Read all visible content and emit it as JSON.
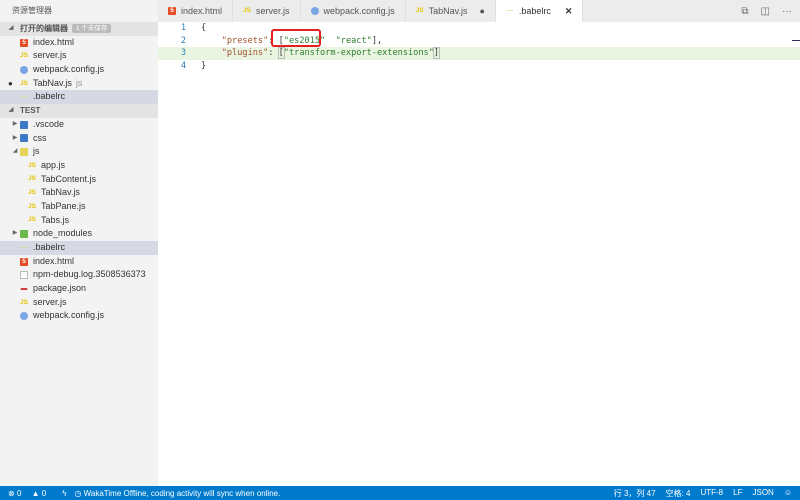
{
  "sidebar": {
    "title": "资源管理器",
    "open_editors": {
      "label": "打开的编辑器",
      "badge": "1 个未保存",
      "items": [
        {
          "name": "index.html",
          "icon": "html"
        },
        {
          "name": "server.js",
          "icon": "js"
        },
        {
          "name": "webpack.config.js",
          "icon": "webpack"
        },
        {
          "name": "TabNav.js",
          "icon": "js",
          "extra": "js",
          "unsaved": true
        },
        {
          "name": ".babelrc",
          "icon": "babel",
          "selected": true
        }
      ]
    },
    "project": {
      "label": "TEST",
      "items": [
        {
          "name": ".vscode",
          "type": "folder"
        },
        {
          "name": "css",
          "type": "folder"
        },
        {
          "name": "js",
          "type": "folder",
          "expanded": true
        },
        {
          "name": "app.js"
        },
        {
          "name": "TabContent.js"
        },
        {
          "name": "TabNav.js"
        },
        {
          "name": "TabPane.js"
        },
        {
          "name": "Tabs.js"
        },
        {
          "name": "node_modules",
          "type": "folder"
        },
        {
          "name": ".babelrc",
          "selected": true
        },
        {
          "name": "index.html"
        },
        {
          "name": "npm-debug.log.3508536373"
        },
        {
          "name": "package.json"
        },
        {
          "name": "server.js"
        },
        {
          "name": "webpack.config.js"
        }
      ]
    }
  },
  "tabs": [
    {
      "label": "index.html"
    },
    {
      "label": "server.js"
    },
    {
      "label": "webpack.config.js"
    },
    {
      "label": "TabNav.js",
      "dirty": "●"
    },
    {
      "label": ".babelrc",
      "close": "✕"
    }
  ],
  "editor": {
    "lines": [
      {
        "n": "1",
        "t": "{"
      },
      {
        "n": "2",
        "key": "\"presets\"",
        "sep": ": ",
        "a": "[",
        "s1": "\"es2015\"",
        "mid": "  ",
        "s2": "\"react\"",
        "end": "],"
      },
      {
        "n": "3",
        "key": "\"plugins\"",
        "sep": ": ",
        "a": "[",
        "s1": "\"transform-export-extensions\"",
        "end": "]"
      },
      {
        "n": "4",
        "t": "}"
      }
    ]
  },
  "status": {
    "errors": "0",
    "warnings": "0",
    "wakatime": "WakaTime Offline, coding activity will sync when online.",
    "position": "行 3，列 47",
    "spaces": "空格: 4",
    "encoding": "UTF-8",
    "eol": "LF",
    "language": "JSON"
  }
}
